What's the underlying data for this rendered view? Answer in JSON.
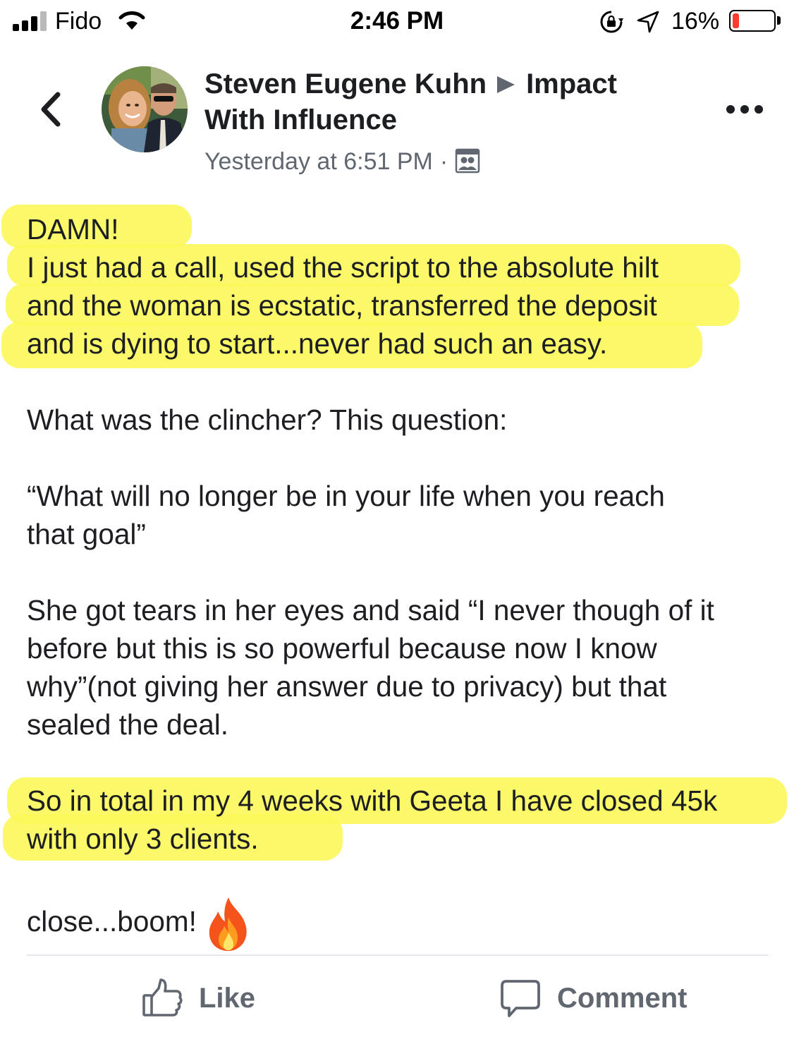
{
  "status_bar": {
    "carrier": "Fido",
    "time": "2:46 PM",
    "battery_percent": "16%",
    "battery_level": 0.16,
    "icons": [
      "signal-icon",
      "wifi-icon",
      "rotation-lock-icon",
      "location-arrow-icon",
      "battery-icon"
    ]
  },
  "header": {
    "author": "Steven Eugene Kuhn",
    "group": "Impact With Influence",
    "timestamp": "Yesterday at 6:51 PM",
    "separator": "·",
    "audience_icon": "group-icon"
  },
  "post": {
    "highlight_color": "#fbf75a",
    "block1": [
      "DAMN!",
      "I just had a call, used the script to the absolute hilt",
      "and the woman is ecstatic, transferred the deposit",
      "and is dying to start...never had such an easy."
    ],
    "p2": "What was the clincher? This question:",
    "p3_line1": "“What will no longer be in your life when you reach",
    "p3_line2": "that goal”",
    "p4_line1": "She got tears in her eyes and said “I never though of it",
    "p4_line2": "before but this is so powerful because now I know",
    "p4_line3": "why”(not giving her answer due to privacy) but that",
    "p4_line4": "sealed the deal.",
    "block5": [
      "So in total in my 4 weeks with Geeta I have closed 45k",
      "with only 3 clients."
    ],
    "p6": "close...boom!",
    "emoji": "fire-icon"
  },
  "actions": {
    "like_label": "Like",
    "comment_label": "Comment"
  }
}
